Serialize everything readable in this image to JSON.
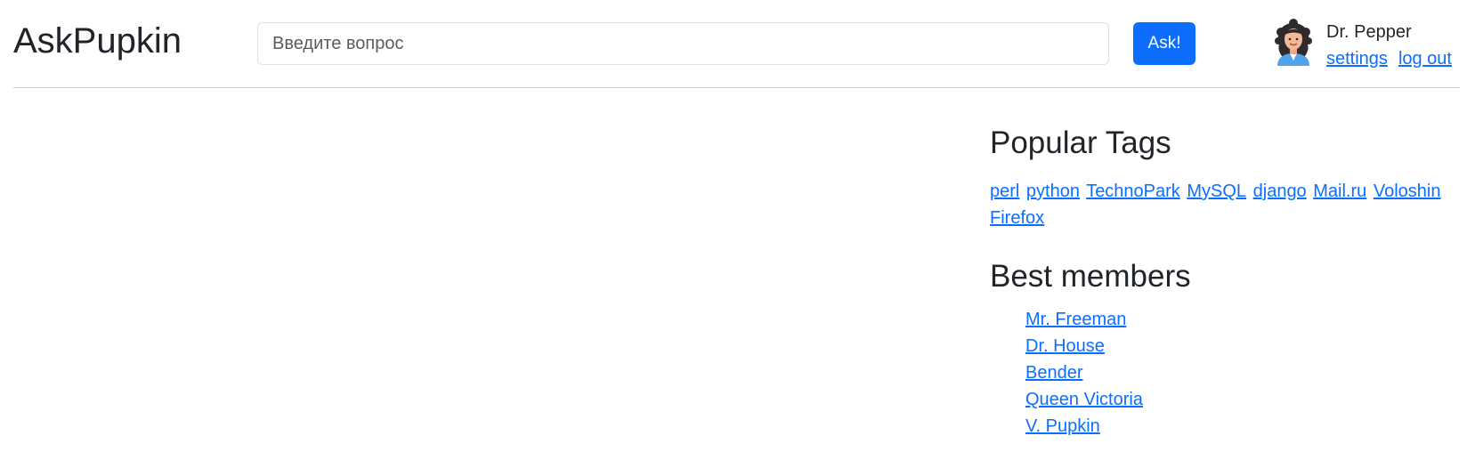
{
  "header": {
    "logo": "AskPupkin",
    "search": {
      "placeholder": "Введите вопрос",
      "value": ""
    },
    "ask_label": "Ask!",
    "user": {
      "name": "Dr. Pepper",
      "settings_label": "settings",
      "logout_label": "log out"
    }
  },
  "sidebar": {
    "tags_title": "Popular Tags",
    "tags": [
      "perl",
      "python",
      "TechnoPark",
      "MySQL",
      "django",
      "Mail.ru",
      "Voloshin",
      "Firefox"
    ],
    "members_title": "Best members",
    "members": [
      "Mr. Freeman",
      "Dr. House",
      "Bender",
      "Queen Victoria",
      "V. Pupkin"
    ]
  },
  "colors": {
    "accent": "#0d6efd",
    "text": "#212529",
    "divider": "#c8cbce"
  },
  "icons": {
    "avatar": "user-avatar-icon"
  }
}
